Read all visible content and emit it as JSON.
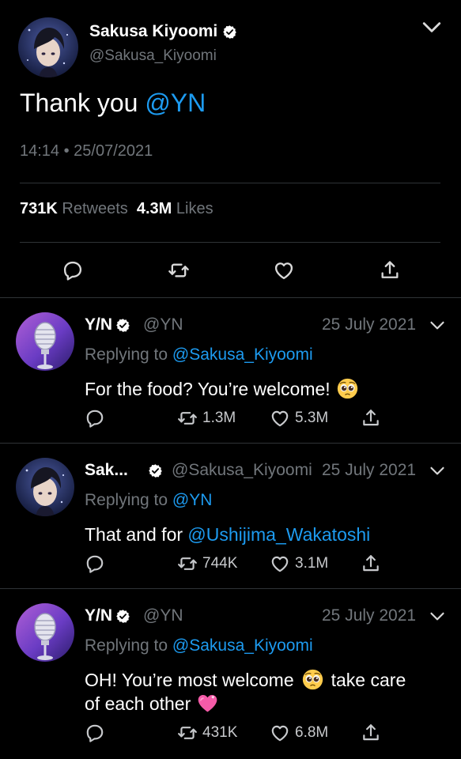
{
  "main": {
    "name": "Sakusa Kiyoomi",
    "handle": "@Sakusa_Kiyoomi",
    "text_plain": "Thank you ",
    "text_mention": "@YN",
    "time": "14:14 • 25/07/2021",
    "retweets": "731K",
    "retweets_label": "Retweets",
    "likes": "4.3M",
    "likes_label": "Likes"
  },
  "replies": [
    {
      "name": "Y/N",
      "handle": "@YN",
      "date": "25 July 2021",
      "replying_prefix": "Replying to",
      "replying_to": "@Sakusa_Kiyoomi",
      "text": "For the food? You’re welcome!",
      "retweets": "1.3M",
      "likes": "5.3M"
    },
    {
      "name": "Sak...",
      "handle": "@Sakusa_Kiyoomi",
      "date": "25 July 2021",
      "replying_prefix": "Replying to",
      "replying_to": "@YN",
      "text_plain": "That and for ",
      "text_mention": "@Ushijima_Wakatoshi",
      "retweets": "744K",
      "likes": "3.1M"
    },
    {
      "name": "Y/N",
      "handle": "@YN",
      "date": "25 July 2021",
      "replying_prefix": "Replying to",
      "replying_to": "@Sakusa_Kiyoomi",
      "text_part1": "OH! You’re most welcome",
      "text_part2": "take care",
      "text_part3": "of each other",
      "retweets": "431K",
      "likes": "6.8M"
    }
  ],
  "colors": {
    "background": "#000000",
    "secondary_text": "#71767b",
    "link": "#1d9bf0",
    "divider": "#2f3336"
  },
  "icons": [
    "verified-badge-icon",
    "chevron-down-icon",
    "reply-icon",
    "retweet-icon",
    "like-icon",
    "share-icon",
    "pleading-face-emoji",
    "sparkling-heart-emoji"
  ]
}
